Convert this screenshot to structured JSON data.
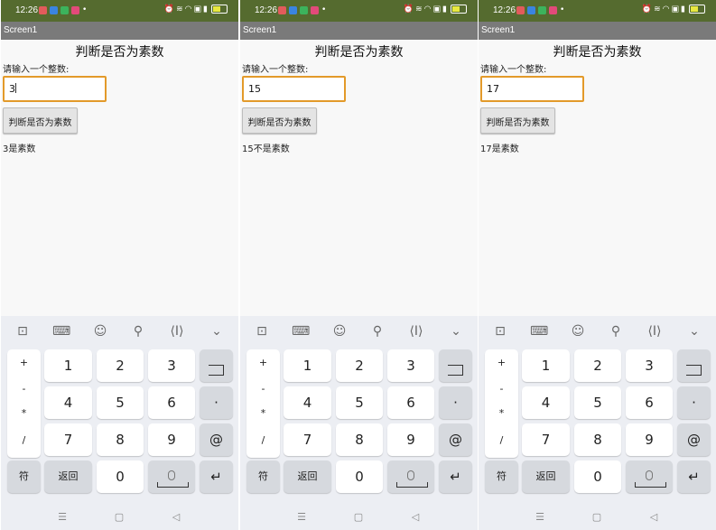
{
  "status": {
    "time": "12:26",
    "icons": [
      "alarm-icon",
      "vibrate-icon",
      "wifi-icon",
      "hd-icon",
      "signal-icon",
      "battery-icon"
    ],
    "notif_colors": [
      "#e25b5b",
      "#3a84e0",
      "#3cb35c",
      "#e24a7a"
    ]
  },
  "app": {
    "title": "Screen1",
    "heading": "判断是否为素数",
    "prompt": "请输入一个整数:",
    "button_label": "判断是否为素数",
    "accent": "#e39a2a"
  },
  "screens": [
    {
      "input_value": "3",
      "result": "3是素数"
    },
    {
      "input_value": "15",
      "result": "15不是素数"
    },
    {
      "input_value": "17",
      "result": "17是素数"
    }
  ],
  "keyboard": {
    "toolbar_icons": [
      "clipboard-icon",
      "keyboard-icon",
      "emoji-icon",
      "search-icon",
      "cursor-icon",
      "collapse-icon"
    ],
    "symbols": [
      "+",
      "-",
      "*",
      "/"
    ],
    "digits": [
      "1",
      "2",
      "3",
      "4",
      "5",
      "6",
      "7",
      "8",
      "9"
    ],
    "dot": "·",
    "at": "@",
    "zero": "0",
    "symbol_key": "符",
    "back_key": "返回"
  },
  "nav": {
    "icons": [
      "menu-icon",
      "home-icon",
      "back-icon"
    ]
  }
}
